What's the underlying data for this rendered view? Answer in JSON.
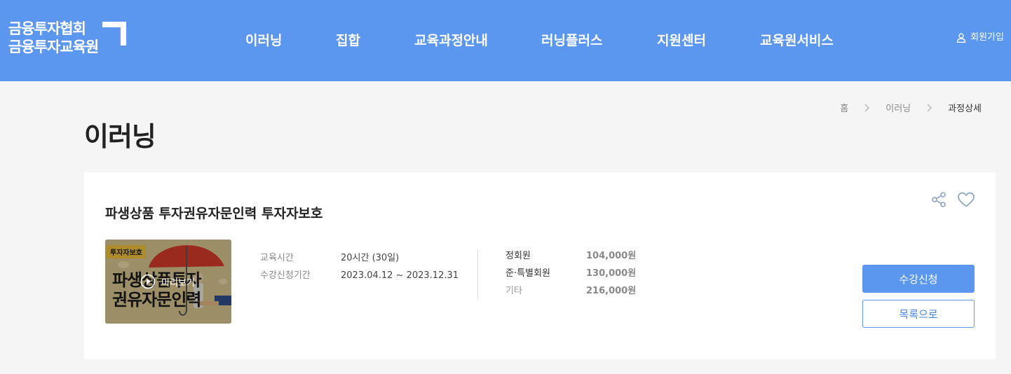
{
  "header": {
    "logo": {
      "line1": "금융투자협회",
      "line2": "금융투자교육원"
    },
    "nav": [
      "이러닝",
      "집합",
      "교육과정안내",
      "러닝플러스",
      "지원센터",
      "교육원서비스"
    ],
    "signup_label": "회원가입"
  },
  "breadcrumb": [
    "홈",
    "이러닝",
    "과정상세"
  ],
  "page_title": "이러닝",
  "course": {
    "title": "파생상품 투자권유자문인력 투자자보호",
    "thumbnail": {
      "badge": "투자자보호",
      "text_line1": "파생상품투자",
      "text_line2": "권유자문인력",
      "preview_label": "미리보기"
    },
    "info": [
      {
        "label": "교육시간",
        "value": "20시간 (30일)"
      },
      {
        "label": "수강신청기간",
        "value": "2023.04.12 ~ 2023.12.31"
      }
    ],
    "prices": [
      {
        "label": "정회원",
        "value": "104,000원"
      },
      {
        "label": "준·특별회원",
        "value": "130,000원"
      },
      {
        "label": "기타",
        "value": "216,000원"
      }
    ],
    "enroll_label": "수강신청",
    "list_label": "목록으로"
  },
  "icons": {
    "share": "share-icon",
    "heart": "heart-icon",
    "play": "play-icon",
    "user": "user-icon",
    "chevron": "chevron-right-icon"
  },
  "colors": {
    "header_bg": "#5b97ee",
    "accent": "#5b97ee",
    "page_bg": "#f5f5f5"
  }
}
